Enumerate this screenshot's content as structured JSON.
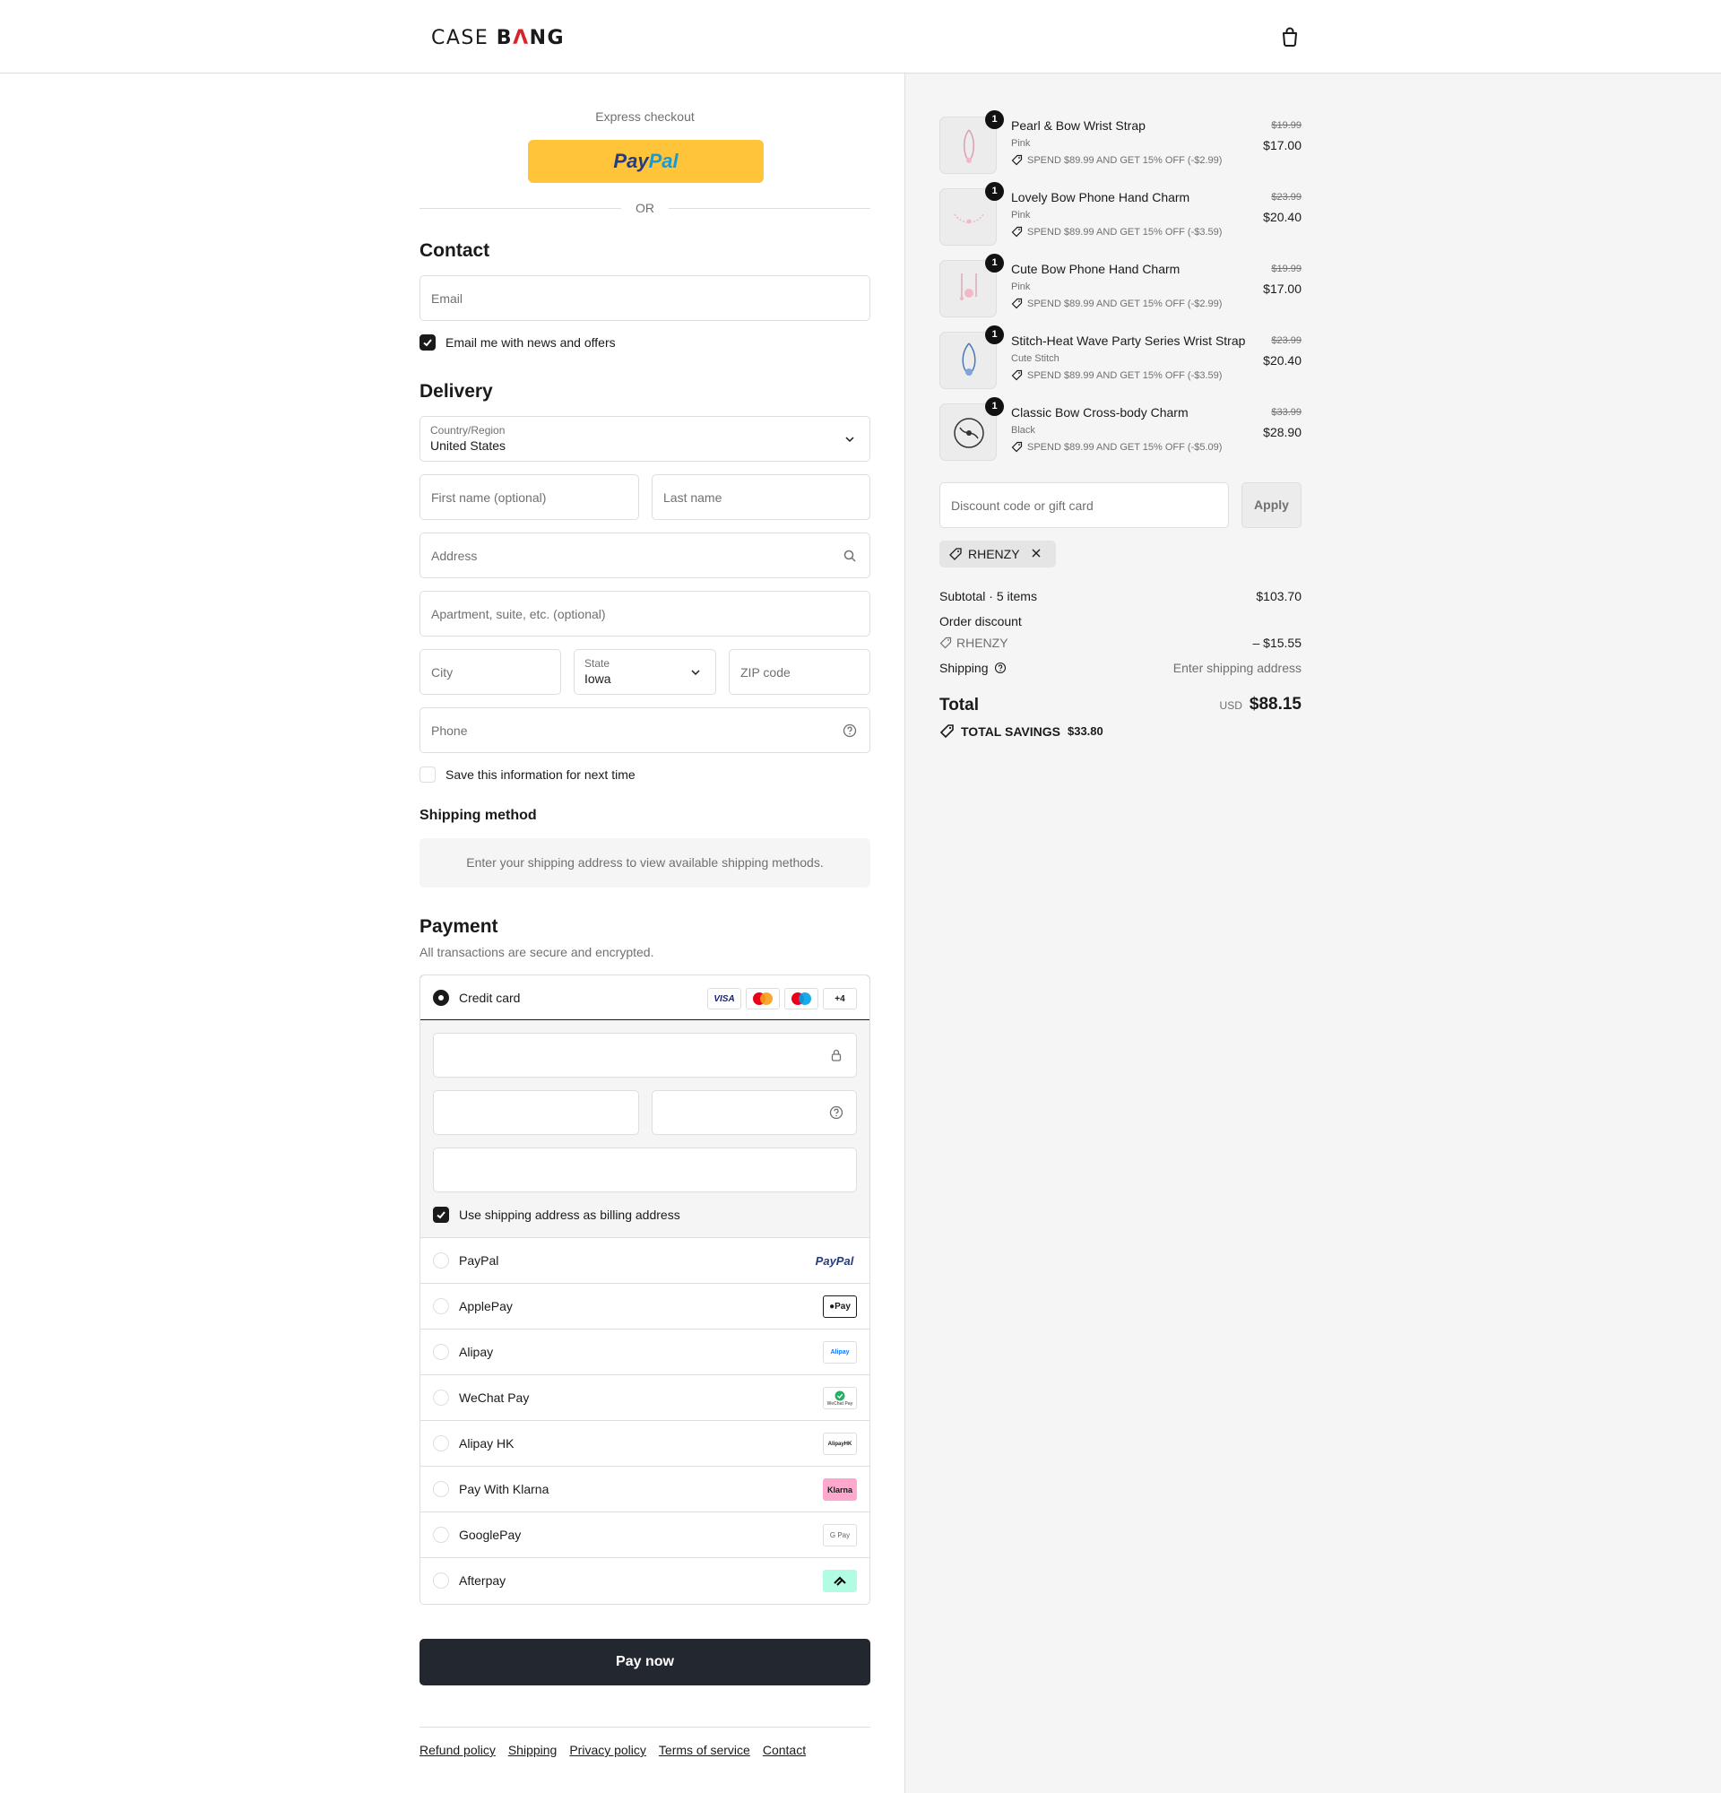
{
  "header": {
    "logo_pre": "CASE ",
    "logo_b": "B",
    "logo_a": "Λ",
    "logo_post": "NG"
  },
  "express": {
    "label": "Express checkout",
    "paypal_part1": "Pay",
    "paypal_part2": "Pal",
    "or_text": "OR"
  },
  "contact": {
    "heading": "Contact",
    "email_placeholder": "Email",
    "news_label": "Email me with news and offers"
  },
  "delivery": {
    "heading": "Delivery",
    "country_label": "Country/Region",
    "country_value": "United States",
    "first_name_placeholder": "First name (optional)",
    "last_name_placeholder": "Last name",
    "address_placeholder": "Address",
    "apartment_placeholder": "Apartment, suite, etc. (optional)",
    "city_placeholder": "City",
    "state_label": "State",
    "state_value": "Iowa",
    "zip_placeholder": "ZIP code",
    "phone_placeholder": "Phone",
    "save_label": "Save this information for next time"
  },
  "shipping_method": {
    "heading": "Shipping method",
    "note": "Enter your shipping address to view available shipping methods."
  },
  "payment": {
    "heading": "Payment",
    "subtitle": "All transactions are secure and encrypted.",
    "credit_card_label": "Credit card",
    "card_icons": [
      "VISA",
      "+4"
    ],
    "billing_label": "Use shipping address as billing address",
    "options": [
      {
        "label": "PayPal",
        "logo": "PayPal"
      },
      {
        "label": "ApplePay",
        "logo": "Pay"
      },
      {
        "label": "Alipay",
        "logo": "Alipay"
      },
      {
        "label": "WeChat Pay",
        "logo": "WeChat Pay"
      },
      {
        "label": "Alipay HK",
        "logo": "AlipayHK"
      },
      {
        "label": "Pay With Klarna",
        "logo": "Klarna"
      },
      {
        "label": "GooglePay",
        "logo": "G Pay"
      },
      {
        "label": "Afterpay",
        "logo": "afterpay"
      }
    ],
    "pay_now": "Pay now"
  },
  "footer": {
    "links": [
      "Refund policy",
      "Shipping",
      "Privacy policy",
      "Terms of service",
      "Contact"
    ]
  },
  "cart": {
    "items": [
      {
        "name": "Pearl & Bow Wrist Strap",
        "variant": "Pink",
        "discount": "SPEND $89.99 AND GET 15% OFF (-$2.99)",
        "old_price": "$19.99",
        "price": "$17.00",
        "qty": "1"
      },
      {
        "name": "Lovely Bow Phone Hand Charm",
        "variant": "Pink",
        "discount": "SPEND $89.99 AND GET 15% OFF (-$3.59)",
        "old_price": "$23.99",
        "price": "$20.40",
        "qty": "1"
      },
      {
        "name": "Cute Bow Phone Hand Charm",
        "variant": "Pink",
        "discount": "SPEND $89.99 AND GET 15% OFF (-$2.99)",
        "old_price": "$19.99",
        "price": "$17.00",
        "qty": "1"
      },
      {
        "name": "Stitch-Heat Wave Party Series Wrist Strap",
        "variant": "Cute Stitch",
        "discount": "SPEND $89.99 AND GET 15% OFF (-$3.59)",
        "old_price": "$23.99",
        "price": "$20.40",
        "qty": "1"
      },
      {
        "name": "Classic Bow Cross-body Charm",
        "variant": "Black",
        "discount": "SPEND $89.99 AND GET 15% OFF (-$5.09)",
        "old_price": "$33.99",
        "price": "$28.90",
        "qty": "1"
      }
    ],
    "discount_placeholder": "Discount code or gift card",
    "apply_label": "Apply",
    "applied_code": "RHENZY",
    "subtotal_label": "Subtotal · 5 items",
    "subtotal_value": "$103.70",
    "order_discount_label": "Order discount",
    "order_discount_code": "RHENZY",
    "order_discount_value": "– $15.55",
    "shipping_label": "Shipping",
    "shipping_value": "Enter shipping address",
    "total_label": "Total",
    "total_currency": "USD",
    "total_value": "$88.15",
    "savings_label": "TOTAL SAVINGS",
    "savings_value": "$33.80"
  },
  "colors": {
    "primary_dark": "#232730",
    "paypal_yellow": "#ffc439",
    "sidebar_bg": "#f5f5f5",
    "logo_red": "#d8232a"
  }
}
